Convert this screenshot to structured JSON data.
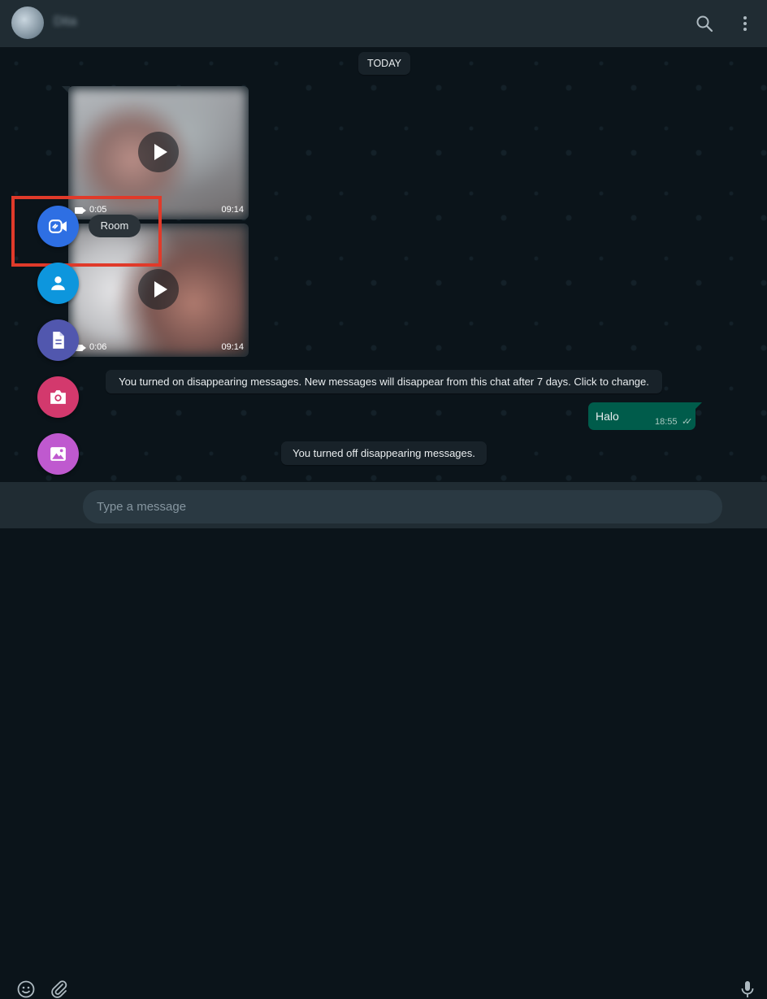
{
  "header": {
    "contact_name": "Dita",
    "icons": [
      "search-icon",
      "menu-icon"
    ]
  },
  "chat": {
    "date_divider": "TODAY",
    "videos": [
      {
        "duration": "0:05",
        "time": "09:14"
      },
      {
        "duration": "0:06",
        "time": "09:14"
      }
    ],
    "system_messages": {
      "turned_on": "You turned on disappearing messages. New messages will disappear from this chat after 7 days. Click to change.",
      "turned_off": "You turned off disappearing messages."
    },
    "outgoing": {
      "text": "Halo",
      "time": "18:55",
      "status": "✓✓"
    }
  },
  "attach_menu": {
    "tooltip": "Room",
    "items": [
      {
        "name": "room",
        "icon": "room-icon",
        "color": "#2e6fe3"
      },
      {
        "name": "contact",
        "icon": "contact-icon",
        "color": "#0d96dd"
      },
      {
        "name": "document",
        "icon": "document-icon",
        "color": "#5157ae"
      },
      {
        "name": "camera",
        "icon": "camera-icon",
        "color": "#d3396d"
      },
      {
        "name": "photos",
        "icon": "photo-icon",
        "color": "#bf59cf"
      }
    ],
    "highlight_color": "#e03a2a"
  },
  "composer": {
    "placeholder": "Type a message"
  }
}
